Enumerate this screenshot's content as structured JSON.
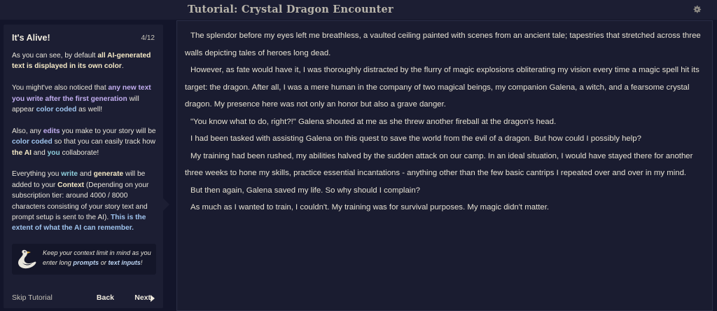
{
  "header": {
    "title": "Tutorial: Crystal Dragon Encounter",
    "settings_icon": "gear-icon"
  },
  "tutorial": {
    "title": "It's Alive!",
    "step": "4/12",
    "p1": {
      "a": "As you can see, by default ",
      "b": "all AI-generated text is displayed in its own color",
      "c": "."
    },
    "p2": {
      "a": "You might've also noticed that ",
      "b": "any new text you write after the first generation",
      "c": " will appear ",
      "d": "color coded",
      "e": " as well!"
    },
    "p3": {
      "a": "Also, any ",
      "b": "edits",
      "c": " you make to your story will be ",
      "d": "color coded",
      "e": " so that you can easily track how ",
      "f": "the AI",
      "g": " and ",
      "h": "you",
      "i": " collaborate!"
    },
    "p4": {
      "a": "Everything you ",
      "b": "write",
      "c": " and ",
      "d": "generate",
      "e": " will be added to your ",
      "f": "Context",
      "g": " (Depending on your subscription tier: around 4000 / 8000 characters consisting of your story text and prompt setup is sent to the AI). ",
      "h": "This is the extent of what the AI can remember."
    },
    "tip": {
      "a": "Keep your context limit in mind as you enter long ",
      "b": "prompts",
      "c": " or ",
      "d": "text inputs",
      "e": "!"
    },
    "skip_label": "Skip Tutorial",
    "back_label": "Back",
    "next_label": "Next"
  },
  "story": {
    "paragraphs": [
      "The splendor before my eyes left me breathless, a vaulted ceiling painted with scenes from an ancient tale; tapestries that stretched across three walls depicting tales of heroes long dead.",
      "However, as fate would have it, I was thoroughly distracted by the flurry of magic explosions obliterating my vision every time a magic spell hit its target: the dragon. After all, I was a mere human in the company of two magical beings, my companion Galena, a witch, and a fearsome crystal dragon. My presence here was not only an honor but also a grave danger.",
      "\"You know what to do, right?!\" Galena shouted at me as she threw another fireball at the dragon's head.",
      "I had been tasked with assisting Galena on this quest to save the world from the evil of a dragon. But how could I possibly help?",
      "My training had been rushed, my abilities halved by the sudden attack on our camp. In an ideal situation, I would have stayed there for another three weeks to hone my skills, practice essential incantations - anything other than the few basic cantrips I repeated over and over in my mind.",
      "But then again, Galena saved my life. So why should I complain?",
      "As much as I wanted to train, I couldn't. My training was for survival purposes. My magic didn't matter."
    ]
  }
}
